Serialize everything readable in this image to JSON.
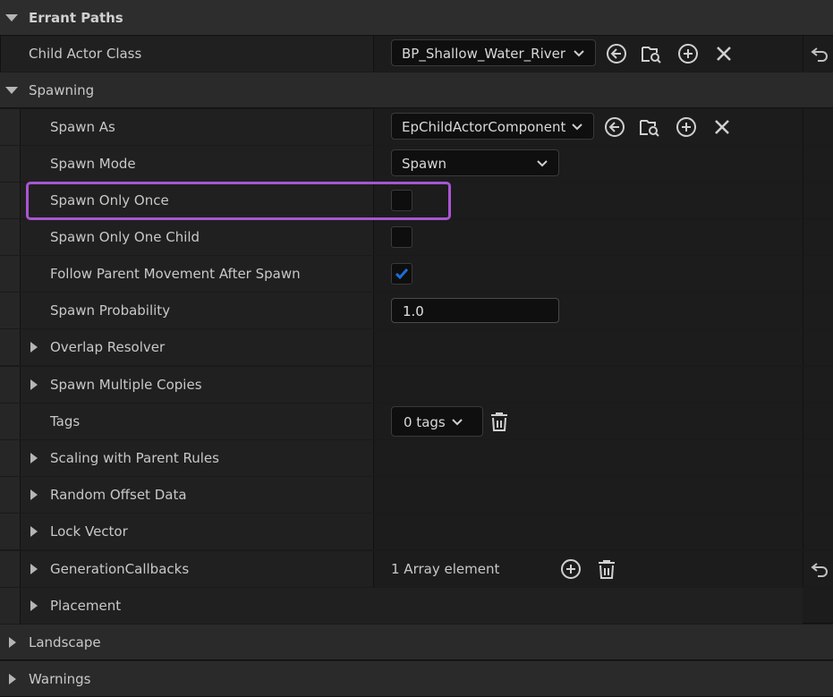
{
  "sections": {
    "errant_paths": "Errant Paths",
    "spawning": "Spawning",
    "landscape": "Landscape",
    "warnings": "Warnings"
  },
  "child_actor_class": {
    "label": "Child Actor Class",
    "value": "BP_Shallow_Water_River"
  },
  "spawn_as": {
    "label": "Spawn As",
    "value": "EpChildActorComponent"
  },
  "spawn_mode": {
    "label": "Spawn Mode",
    "value": "Spawn"
  },
  "spawn_only_once": {
    "label": "Spawn Only Once",
    "checked": false
  },
  "spawn_only_one_child": {
    "label": "Spawn Only One Child",
    "checked": false
  },
  "follow_parent": {
    "label": "Follow Parent Movement After Spawn",
    "checked": true
  },
  "spawn_probability": {
    "label": "Spawn Probability",
    "value": "1.0"
  },
  "overlap_resolver": "Overlap Resolver",
  "spawn_multiple_copies": "Spawn Multiple Copies",
  "tags": {
    "label": "Tags",
    "value": "0 tags"
  },
  "scaling": "Scaling with Parent Rules",
  "random_offset": "Random Offset Data",
  "lock_vector": "Lock Vector",
  "generation_callbacks": {
    "label": "GenerationCallbacks",
    "value": "1 Array element"
  },
  "placement": "Placement",
  "colors": {
    "accent_check": "#1a6fd9",
    "highlight": "#a955d4"
  }
}
